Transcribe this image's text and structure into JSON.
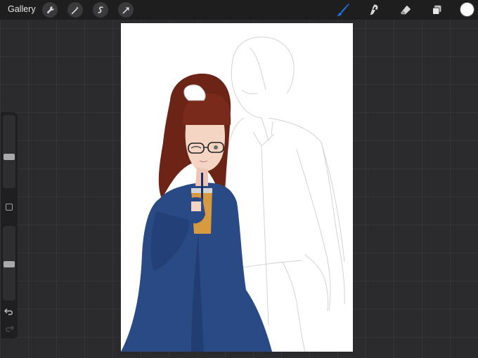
{
  "topbar": {
    "gallery_label": "Gallery",
    "left_tools": [
      "wrench-icon",
      "magic-wand-icon",
      "selection-icon",
      "transform-arrow-icon"
    ],
    "right_tools": [
      "brush-icon",
      "smudge-icon",
      "eraser-icon",
      "layers-icon"
    ],
    "active_tool": "brush-icon",
    "active_tool_color": "#1e6fe0",
    "current_color": "#ffffff"
  },
  "sidebar": {
    "brush_size_level": 0.42,
    "brush_opacity_level": 0.48,
    "buttons": [
      "modify-button",
      "undo-icon",
      "redo-icon"
    ]
  },
  "canvas": {
    "background": "#ffffff",
    "artwork": "girl-with-drink-and-sketched-figure"
  },
  "colors": {
    "topbar_bg": "#1e1e1f",
    "workspace_bg": "#2b2b2d",
    "sweater": "#2a4a86",
    "hair": "#6b2416"
  }
}
